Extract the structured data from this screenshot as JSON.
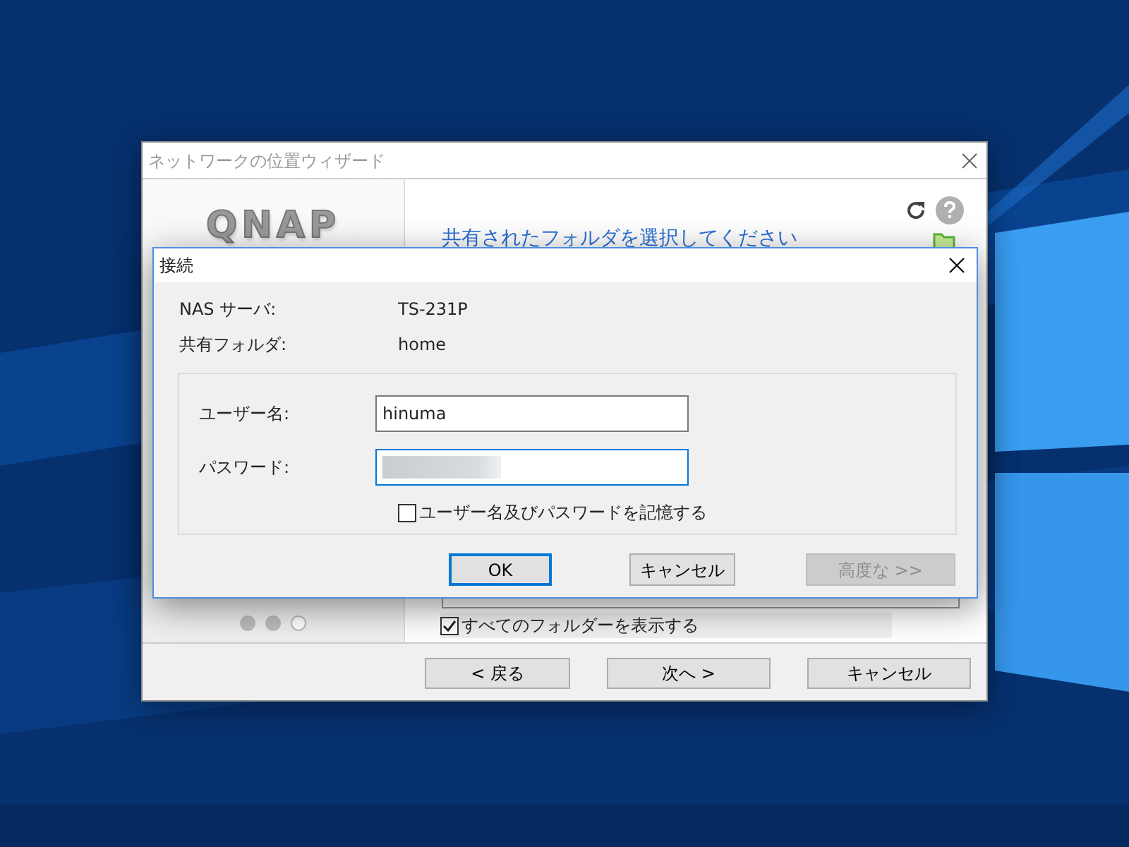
{
  "wizard": {
    "title": "ネットワークの位置ウィザード",
    "logo": "QNAP",
    "heading": "共有されたフォルダを選択してください",
    "steps": [
      {
        "done": true
      },
      {
        "done": true
      },
      {
        "done": false
      }
    ],
    "show_all_folders": {
      "label": "すべてのフォルダーを表示する",
      "checked": true
    },
    "buttons": [
      {
        "label": "< 戻る",
        "disabled": false
      },
      {
        "label": "次へ >",
        "disabled": false
      },
      {
        "label": "キャンセル",
        "disabled": false
      }
    ]
  },
  "dialog": {
    "title": "接続",
    "info": [
      {
        "label": "NAS サーバ:",
        "value": "TS-231P"
      },
      {
        "label": "共有フォルダ:",
        "value": "home"
      }
    ],
    "fields": [
      {
        "kind": "text",
        "label": "ユーザー名:",
        "value": "hinuma",
        "focused": false
      },
      {
        "kind": "password",
        "label": "パスワード:",
        "focused": true
      }
    ],
    "remember": {
      "label": "ユーザー名及びパスワードを記憶する",
      "checked": false
    },
    "buttons": [
      {
        "label": "OK",
        "default": true,
        "disabled": false
      },
      {
        "label": "キャンセル",
        "default": false,
        "disabled": false
      },
      {
        "label": "高度な >>",
        "default": false,
        "disabled": true
      }
    ]
  }
}
